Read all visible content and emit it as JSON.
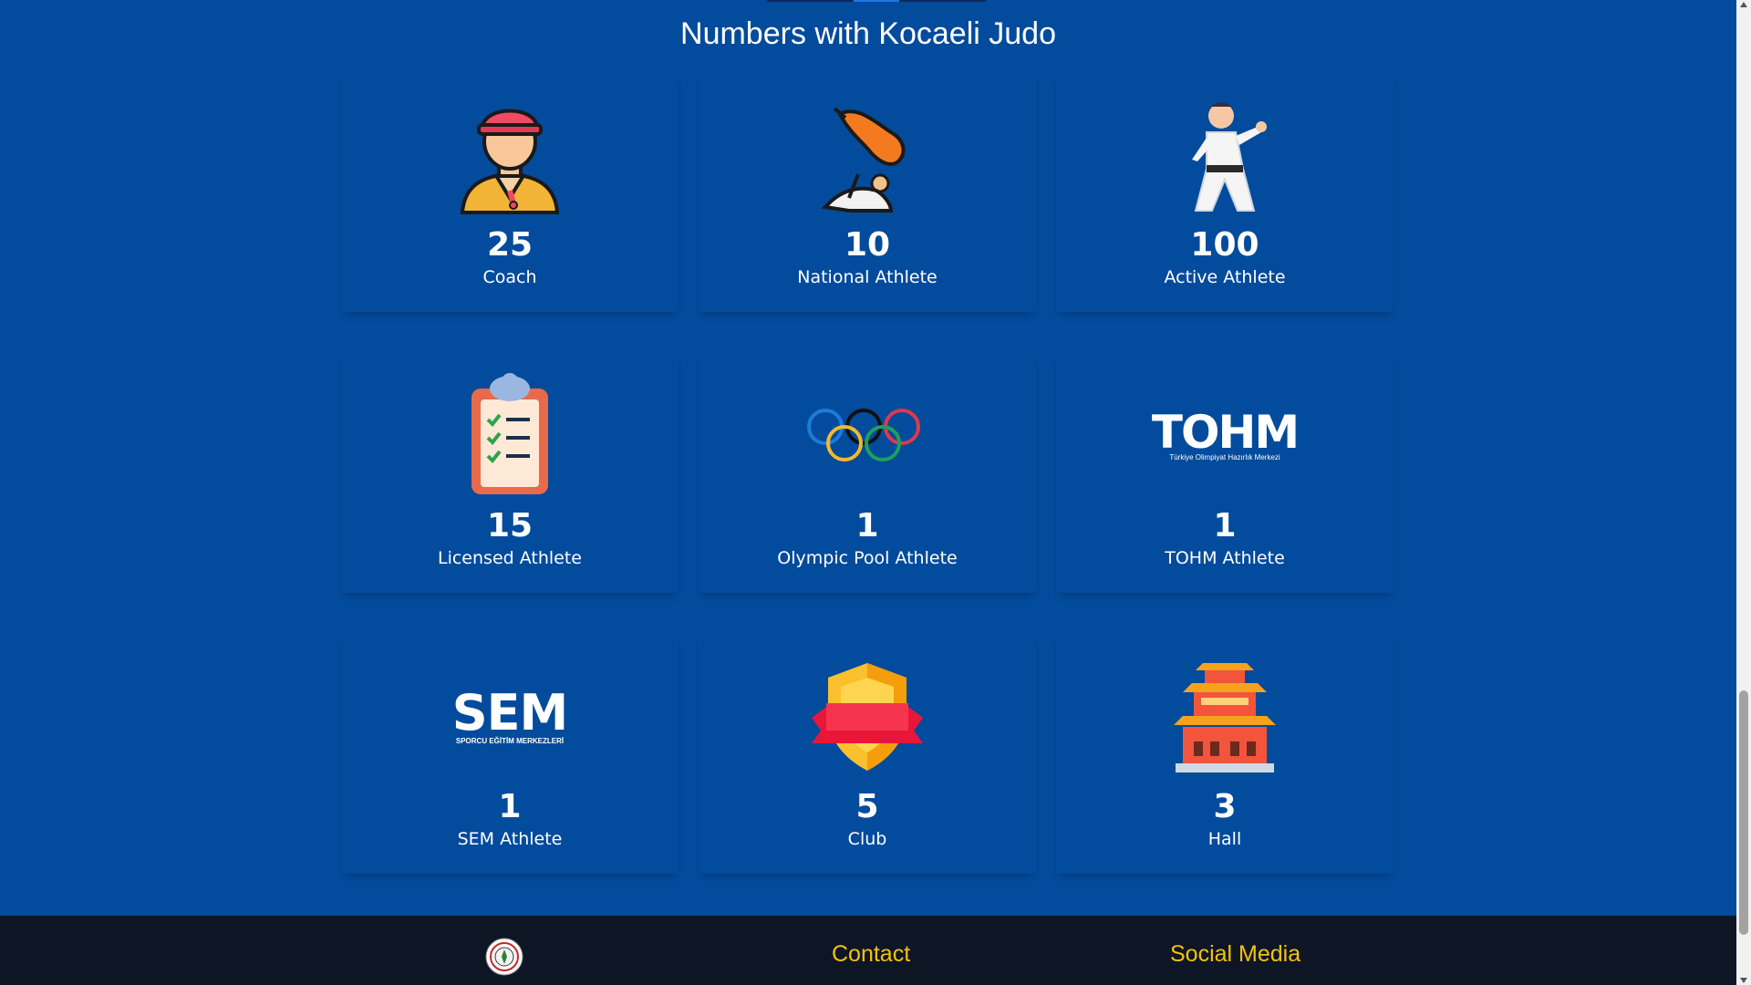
{
  "page": {
    "title": "Numbers with Kocaeli Judo"
  },
  "stats": [
    {
      "value": "25",
      "label": "Coach",
      "icon": "coach-icon"
    },
    {
      "value": "10",
      "label": "National Athlete",
      "icon": "judo-throw-icon"
    },
    {
      "value": "100",
      "label": "Active Athlete",
      "icon": "karate-athlete-icon"
    },
    {
      "value": "15",
      "label": "Licensed Athlete",
      "icon": "clipboard-checklist-icon"
    },
    {
      "value": "1",
      "label": "Olympic Pool Athlete",
      "icon": "olympic-rings-icon"
    },
    {
      "value": "1",
      "label": "TOHM Athlete",
      "icon": "tohm-logo"
    },
    {
      "value": "1",
      "label": "SEM Athlete",
      "icon": "sem-logo"
    },
    {
      "value": "5",
      "label": "Club",
      "icon": "shield-badge-icon"
    },
    {
      "value": "3",
      "label": "Hall",
      "icon": "pagoda-hall-icon"
    }
  ],
  "logos": {
    "tohm_main": "TOHM",
    "tohm_sub": "Türkiye Olimpiyat Hazırlık Merkezi",
    "sem_main": "SEM",
    "sem_sub": "SPORCU EĞİTİM MERKEZLERİ"
  },
  "footer": {
    "contact": "Contact",
    "social": "Social Media"
  },
  "colors": {
    "background": "#034b9c",
    "footer": "#0e1626",
    "footer_link": "#f5c20b",
    "text": "#ffffff"
  }
}
